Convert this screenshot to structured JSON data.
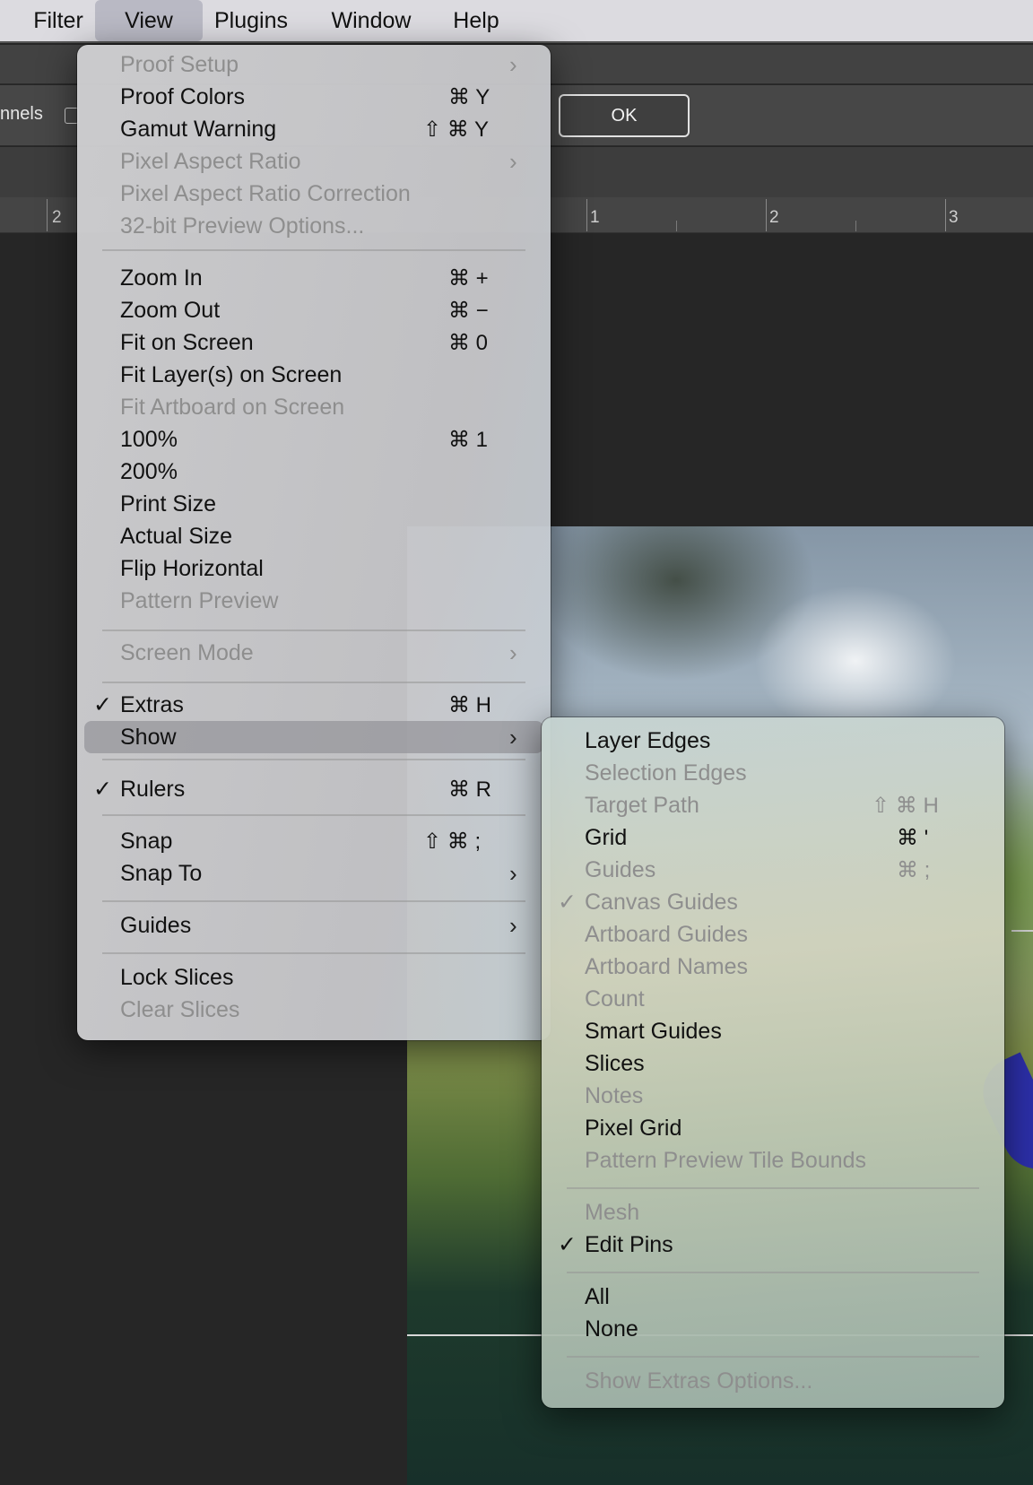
{
  "menubar": {
    "items": [
      {
        "label": "Filter"
      },
      {
        "label": "View"
      },
      {
        "label": "Plugins"
      },
      {
        "label": "Window"
      },
      {
        "label": "Help"
      }
    ]
  },
  "options_bar": {
    "channels_label": "nnels",
    "ok_label": "OK"
  },
  "ruler": {
    "labels": [
      "2",
      "1",
      "2",
      "3"
    ]
  },
  "view_menu": {
    "items": [
      {
        "label": "Proof Setup",
        "shortcut": "",
        "enabled": false,
        "submenu": true
      },
      {
        "label": "Proof Colors",
        "shortcut": "⌘Y",
        "enabled": true
      },
      {
        "label": "Gamut Warning",
        "shortcut": "⇧⌘Y",
        "enabled": true
      },
      {
        "label": "Pixel Aspect Ratio",
        "shortcut": "",
        "enabled": false,
        "submenu": true
      },
      {
        "label": "Pixel Aspect Ratio Correction",
        "shortcut": "",
        "enabled": false
      },
      {
        "label": "32-bit Preview Options...",
        "shortcut": "",
        "enabled": false
      },
      {
        "label": "Zoom In",
        "shortcut": "⌘+",
        "enabled": true
      },
      {
        "label": "Zoom Out",
        "shortcut": "⌘−",
        "enabled": true
      },
      {
        "label": "Fit on Screen",
        "shortcut": "⌘0",
        "enabled": true
      },
      {
        "label": "Fit Layer(s) on Screen",
        "shortcut": "",
        "enabled": true
      },
      {
        "label": "Fit Artboard on Screen",
        "shortcut": "",
        "enabled": false
      },
      {
        "label": "100%",
        "shortcut": "⌘1",
        "enabled": true
      },
      {
        "label": "200%",
        "shortcut": "",
        "enabled": true
      },
      {
        "label": "Print Size",
        "shortcut": "",
        "enabled": true
      },
      {
        "label": "Actual Size",
        "shortcut": "",
        "enabled": true
      },
      {
        "label": "Flip Horizontal",
        "shortcut": "",
        "enabled": true
      },
      {
        "label": "Pattern Preview",
        "shortcut": "",
        "enabled": false
      },
      {
        "label": "Screen Mode",
        "shortcut": "",
        "enabled": false,
        "submenu": true
      },
      {
        "label": "Extras",
        "shortcut": "⌘H",
        "enabled": true,
        "checked": true
      },
      {
        "label": "Show",
        "shortcut": "",
        "enabled": true,
        "submenu": true,
        "highlighted": true
      },
      {
        "label": "Rulers",
        "shortcut": "⌘R",
        "enabled": true,
        "checked": true
      },
      {
        "label": "Snap",
        "shortcut": "⇧⌘;",
        "enabled": true
      },
      {
        "label": "Snap To",
        "shortcut": "",
        "enabled": true,
        "submenu": true
      },
      {
        "label": "Guides",
        "shortcut": "",
        "enabled": true,
        "submenu": true
      },
      {
        "label": "Lock Slices",
        "shortcut": "",
        "enabled": true
      },
      {
        "label": "Clear Slices",
        "shortcut": "",
        "enabled": false
      }
    ],
    "check_glyph": "✓",
    "arrow_glyph": "›"
  },
  "show_menu": {
    "items": [
      {
        "label": "Layer Edges",
        "shortcut": "",
        "enabled": true
      },
      {
        "label": "Selection Edges",
        "shortcut": "",
        "enabled": false
      },
      {
        "label": "Target Path",
        "shortcut": "⇧⌘H",
        "enabled": false
      },
      {
        "label": "Grid",
        "shortcut": "⌘'",
        "enabled": true
      },
      {
        "label": "Guides",
        "shortcut": "⌘;",
        "enabled": false
      },
      {
        "label": "Canvas Guides",
        "shortcut": "",
        "enabled": false,
        "checked": true
      },
      {
        "label": "Artboard Guides",
        "shortcut": "",
        "enabled": false
      },
      {
        "label": "Artboard Names",
        "shortcut": "",
        "enabled": false
      },
      {
        "label": "Count",
        "shortcut": "",
        "enabled": false
      },
      {
        "label": "Smart Guides",
        "shortcut": "",
        "enabled": true
      },
      {
        "label": "Slices",
        "shortcut": "",
        "enabled": true
      },
      {
        "label": "Notes",
        "shortcut": "",
        "enabled": false
      },
      {
        "label": "Pixel Grid",
        "shortcut": "",
        "enabled": true
      },
      {
        "label": "Pattern Preview Tile Bounds",
        "shortcut": "",
        "enabled": false
      },
      {
        "label": "Mesh",
        "shortcut": "",
        "enabled": false
      },
      {
        "label": "Edit Pins",
        "shortcut": "",
        "enabled": true,
        "checked": true
      },
      {
        "label": "All",
        "shortcut": "",
        "enabled": true
      },
      {
        "label": "None",
        "shortcut": "",
        "enabled": true
      },
      {
        "label": "Show Extras Options...",
        "shortcut": "",
        "enabled": false
      }
    ]
  }
}
